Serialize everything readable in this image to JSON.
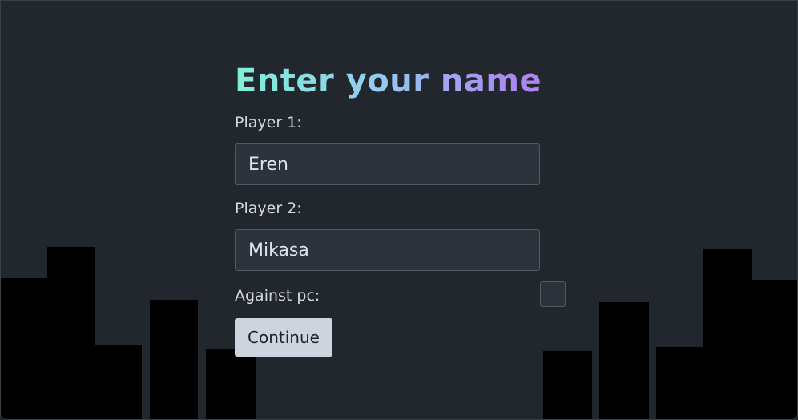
{
  "title": "Enter your name",
  "player1": {
    "label": "Player 1:",
    "value": "Eren"
  },
  "player2": {
    "label": "Player 2:",
    "value": "Mikasa"
  },
  "against_pc": {
    "label": "Against pc:",
    "checked": false
  },
  "continue_label": "Continue",
  "colors": {
    "background": "#22262d",
    "skyline": "#000000",
    "input_bg": "#2d333c",
    "button_bg": "#ccd5df",
    "title_gradient_start": "#7ff0d9",
    "title_gradient_end": "#b07ff2"
  }
}
